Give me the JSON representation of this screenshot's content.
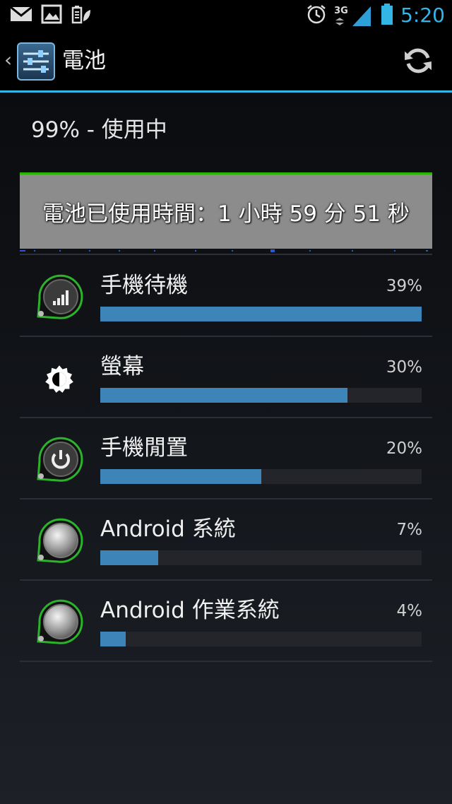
{
  "status_bar": {
    "time": "5:20",
    "network": "3G",
    "icons": [
      "mail-icon",
      "image-icon",
      "battery-saver-icon",
      "alarm-icon",
      "signal-icon",
      "battery-icon"
    ]
  },
  "action_bar": {
    "title": "電池",
    "app_icon": "settings-sliders-icon",
    "refresh_icon": "refresh-icon"
  },
  "summary": "99% - 使用中",
  "graph_text": "電池已使用時間：1 小時 59 分 51 秒",
  "colors": {
    "accent": "#33b5e5",
    "bar": "#3d85b8",
    "graph_bg": "#8c8c8c",
    "graph_line": "#26b600",
    "icon_ring": "#2bb42b"
  },
  "items": [
    {
      "label": "手機待機",
      "percent": "39%",
      "fraction": 1.0,
      "icon": "cell-standby-icon"
    },
    {
      "label": "螢幕",
      "percent": "30%",
      "fraction": 0.77,
      "icon": "brightness-icon"
    },
    {
      "label": "手機閒置",
      "percent": "20%",
      "fraction": 0.5,
      "icon": "power-idle-icon"
    },
    {
      "label": "Android 系統",
      "percent": "7%",
      "fraction": 0.18,
      "icon": "android-system-icon"
    },
    {
      "label": "Android 作業系統",
      "percent": "4%",
      "fraction": 0.08,
      "icon": "android-os-icon"
    }
  ]
}
